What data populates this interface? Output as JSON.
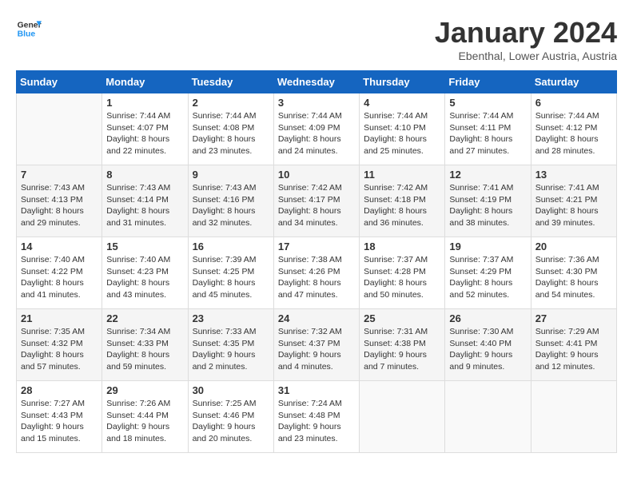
{
  "header": {
    "logo_line1": "General",
    "logo_line2": "Blue",
    "title": "January 2024",
    "subtitle": "Ebenthal, Lower Austria, Austria"
  },
  "weekdays": [
    "Sunday",
    "Monday",
    "Tuesday",
    "Wednesday",
    "Thursday",
    "Friday",
    "Saturday"
  ],
  "weeks": [
    [
      {
        "day": "",
        "empty": true
      },
      {
        "day": "1",
        "sunrise": "Sunrise: 7:44 AM",
        "sunset": "Sunset: 4:07 PM",
        "daylight": "Daylight: 8 hours and 22 minutes."
      },
      {
        "day": "2",
        "sunrise": "Sunrise: 7:44 AM",
        "sunset": "Sunset: 4:08 PM",
        "daylight": "Daylight: 8 hours and 23 minutes."
      },
      {
        "day": "3",
        "sunrise": "Sunrise: 7:44 AM",
        "sunset": "Sunset: 4:09 PM",
        "daylight": "Daylight: 8 hours and 24 minutes."
      },
      {
        "day": "4",
        "sunrise": "Sunrise: 7:44 AM",
        "sunset": "Sunset: 4:10 PM",
        "daylight": "Daylight: 8 hours and 25 minutes."
      },
      {
        "day": "5",
        "sunrise": "Sunrise: 7:44 AM",
        "sunset": "Sunset: 4:11 PM",
        "daylight": "Daylight: 8 hours and 27 minutes."
      },
      {
        "day": "6",
        "sunrise": "Sunrise: 7:44 AM",
        "sunset": "Sunset: 4:12 PM",
        "daylight": "Daylight: 8 hours and 28 minutes."
      }
    ],
    [
      {
        "day": "7",
        "sunrise": "Sunrise: 7:43 AM",
        "sunset": "Sunset: 4:13 PM",
        "daylight": "Daylight: 8 hours and 29 minutes."
      },
      {
        "day": "8",
        "sunrise": "Sunrise: 7:43 AM",
        "sunset": "Sunset: 4:14 PM",
        "daylight": "Daylight: 8 hours and 31 minutes."
      },
      {
        "day": "9",
        "sunrise": "Sunrise: 7:43 AM",
        "sunset": "Sunset: 4:16 PM",
        "daylight": "Daylight: 8 hours and 32 minutes."
      },
      {
        "day": "10",
        "sunrise": "Sunrise: 7:42 AM",
        "sunset": "Sunset: 4:17 PM",
        "daylight": "Daylight: 8 hours and 34 minutes."
      },
      {
        "day": "11",
        "sunrise": "Sunrise: 7:42 AM",
        "sunset": "Sunset: 4:18 PM",
        "daylight": "Daylight: 8 hours and 36 minutes."
      },
      {
        "day": "12",
        "sunrise": "Sunrise: 7:41 AM",
        "sunset": "Sunset: 4:19 PM",
        "daylight": "Daylight: 8 hours and 38 minutes."
      },
      {
        "day": "13",
        "sunrise": "Sunrise: 7:41 AM",
        "sunset": "Sunset: 4:21 PM",
        "daylight": "Daylight: 8 hours and 39 minutes."
      }
    ],
    [
      {
        "day": "14",
        "sunrise": "Sunrise: 7:40 AM",
        "sunset": "Sunset: 4:22 PM",
        "daylight": "Daylight: 8 hours and 41 minutes."
      },
      {
        "day": "15",
        "sunrise": "Sunrise: 7:40 AM",
        "sunset": "Sunset: 4:23 PM",
        "daylight": "Daylight: 8 hours and 43 minutes."
      },
      {
        "day": "16",
        "sunrise": "Sunrise: 7:39 AM",
        "sunset": "Sunset: 4:25 PM",
        "daylight": "Daylight: 8 hours and 45 minutes."
      },
      {
        "day": "17",
        "sunrise": "Sunrise: 7:38 AM",
        "sunset": "Sunset: 4:26 PM",
        "daylight": "Daylight: 8 hours and 47 minutes."
      },
      {
        "day": "18",
        "sunrise": "Sunrise: 7:37 AM",
        "sunset": "Sunset: 4:28 PM",
        "daylight": "Daylight: 8 hours and 50 minutes."
      },
      {
        "day": "19",
        "sunrise": "Sunrise: 7:37 AM",
        "sunset": "Sunset: 4:29 PM",
        "daylight": "Daylight: 8 hours and 52 minutes."
      },
      {
        "day": "20",
        "sunrise": "Sunrise: 7:36 AM",
        "sunset": "Sunset: 4:30 PM",
        "daylight": "Daylight: 8 hours and 54 minutes."
      }
    ],
    [
      {
        "day": "21",
        "sunrise": "Sunrise: 7:35 AM",
        "sunset": "Sunset: 4:32 PM",
        "daylight": "Daylight: 8 hours and 57 minutes."
      },
      {
        "day": "22",
        "sunrise": "Sunrise: 7:34 AM",
        "sunset": "Sunset: 4:33 PM",
        "daylight": "Daylight: 8 hours and 59 minutes."
      },
      {
        "day": "23",
        "sunrise": "Sunrise: 7:33 AM",
        "sunset": "Sunset: 4:35 PM",
        "daylight": "Daylight: 9 hours and 2 minutes."
      },
      {
        "day": "24",
        "sunrise": "Sunrise: 7:32 AM",
        "sunset": "Sunset: 4:37 PM",
        "daylight": "Daylight: 9 hours and 4 minutes."
      },
      {
        "day": "25",
        "sunrise": "Sunrise: 7:31 AM",
        "sunset": "Sunset: 4:38 PM",
        "daylight": "Daylight: 9 hours and 7 minutes."
      },
      {
        "day": "26",
        "sunrise": "Sunrise: 7:30 AM",
        "sunset": "Sunset: 4:40 PM",
        "daylight": "Daylight: 9 hours and 9 minutes."
      },
      {
        "day": "27",
        "sunrise": "Sunrise: 7:29 AM",
        "sunset": "Sunset: 4:41 PM",
        "daylight": "Daylight: 9 hours and 12 minutes."
      }
    ],
    [
      {
        "day": "28",
        "sunrise": "Sunrise: 7:27 AM",
        "sunset": "Sunset: 4:43 PM",
        "daylight": "Daylight: 9 hours and 15 minutes."
      },
      {
        "day": "29",
        "sunrise": "Sunrise: 7:26 AM",
        "sunset": "Sunset: 4:44 PM",
        "daylight": "Daylight: 9 hours and 18 minutes."
      },
      {
        "day": "30",
        "sunrise": "Sunrise: 7:25 AM",
        "sunset": "Sunset: 4:46 PM",
        "daylight": "Daylight: 9 hours and 20 minutes."
      },
      {
        "day": "31",
        "sunrise": "Sunrise: 7:24 AM",
        "sunset": "Sunset: 4:48 PM",
        "daylight": "Daylight: 9 hours and 23 minutes."
      },
      {
        "day": "",
        "empty": true
      },
      {
        "day": "",
        "empty": true
      },
      {
        "day": "",
        "empty": true
      }
    ]
  ]
}
